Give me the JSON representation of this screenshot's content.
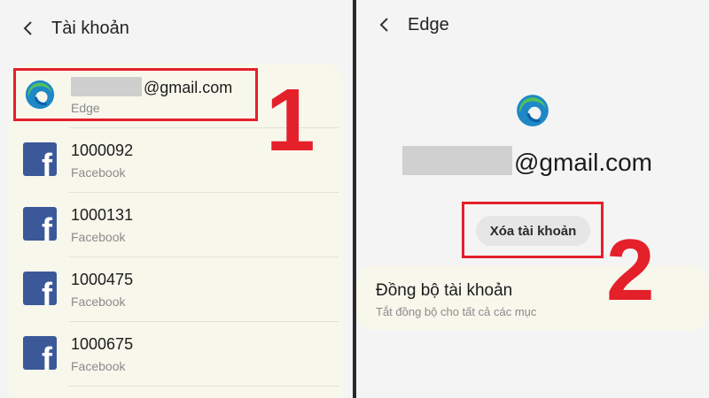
{
  "left": {
    "header": {
      "title": "Tài khoản"
    },
    "accounts": [
      {
        "primary": "@gmail.com",
        "secondary": "Edge",
        "icon": "edge-icon",
        "redacted": true
      },
      {
        "primary": "1000092",
        "secondary": "Facebook",
        "icon": "facebook-icon"
      },
      {
        "primary": "1000131",
        "secondary": "Facebook",
        "icon": "facebook-icon"
      },
      {
        "primary": "1000475",
        "secondary": "Facebook",
        "icon": "facebook-icon"
      },
      {
        "primary": "1000675",
        "secondary": "Facebook",
        "icon": "facebook-icon"
      }
    ],
    "step_number": "1"
  },
  "right": {
    "header": {
      "title": "Edge"
    },
    "email": "@gmail.com",
    "remove_button": "Xóa tài khoản",
    "sync": {
      "title": "Đồng bộ tài khoản",
      "subtitle": "Tắt đồng bộ cho tất cả các mục"
    },
    "step_number": "2"
  },
  "colors": {
    "highlight": "#e4202a",
    "facebook": "#3b5998",
    "card": "#f8f7ec",
    "background": "#f4f4f4"
  }
}
